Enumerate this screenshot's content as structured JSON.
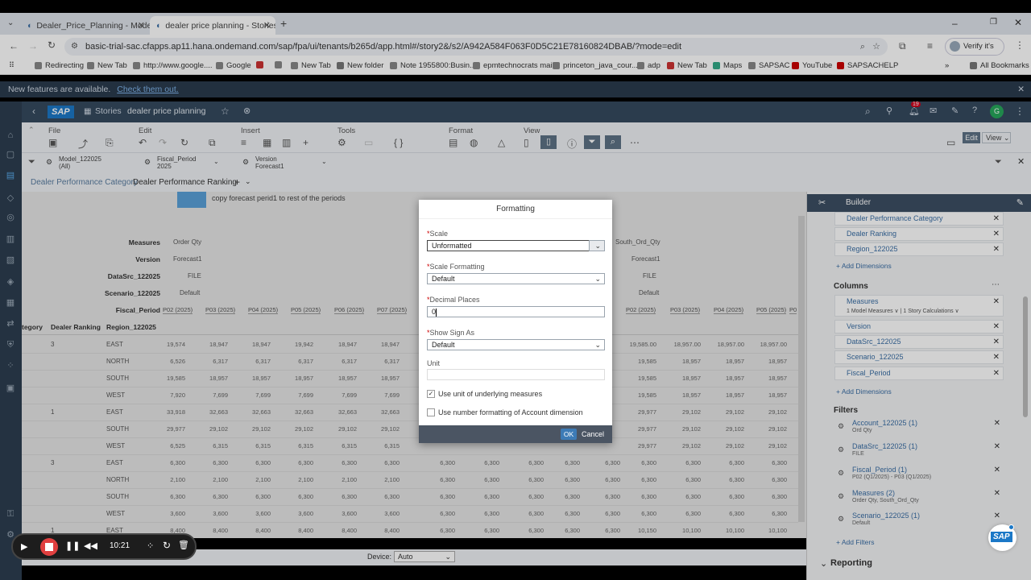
{
  "browser": {
    "tabs": [
      {
        "title": "Dealer_Price_Planning - Modeler"
      },
      {
        "title": "dealer price planning - Stories"
      }
    ],
    "new_tab_icon": "+",
    "url": "basic-trial-sac.cfapps.ap11.hana.ondemand.com/sap/fpa/ui/tenants/b265d/app.html#/story2&/s2/A942A584F063F0D5C21E78160824DBAB/?mode=edit",
    "profile_label": "Verify it's you",
    "bookmarks": [
      "Redirecting",
      "New Tab",
      "http://www.google....",
      "Google",
      "",
      "New Tab",
      "New folder",
      "Note 1955800:Busin...",
      "epmtechnocrats mail",
      "princeton_java_cour...",
      "adp",
      "New Tab",
      "Maps",
      "SAPSAC",
      "YouTube",
      "SAPSACHELP"
    ],
    "all_bookmarks": "All Bookmarks"
  },
  "notification": {
    "text": "New features are available.",
    "link": "Check them out."
  },
  "shell": {
    "logo": "SAP",
    "nav": "Stories",
    "story_name": "dealer price planning",
    "badge": "19",
    "avatar": "G"
  },
  "toolbar": {
    "sections": [
      "File",
      "Edit",
      "Insert",
      "Tools",
      "Format",
      "View"
    ],
    "edit_label": "Edit",
    "view_label": "View"
  },
  "filters": [
    {
      "name": "Model_122025",
      "value": "(All)"
    },
    {
      "name": "Fiscal_Period",
      "value": "2025"
    },
    {
      "name": "Version",
      "value": "Forecast1"
    }
  ],
  "page_tabs": [
    "Dealer Performance Category",
    "Dealer Performance Ranking"
  ],
  "canvas": {
    "banner_text": "copy forecast perid1 to rest of the periods",
    "header_rows": [
      {
        "label": "Measures",
        "value": "Order Qty",
        "right": "South_Ord_Qty"
      },
      {
        "label": "Version",
        "value": "Forecast1",
        "right": "Forecast1"
      },
      {
        "label": "DataSrc_122025",
        "value": "FILE",
        "right": "FILE"
      },
      {
        "label": "Scenario_122025",
        "value": "Default",
        "right": "Default"
      }
    ],
    "fiscal_label": "Fiscal_Period",
    "periods_left": [
      "P02 (2025)",
      "P03 (2025)",
      "P04 (2025)",
      "P05 (2025)",
      "P06 (2025)",
      "P07 (2025)"
    ],
    "periods_right": [
      "P02 (2025)",
      "P03 (2025)",
      "P04 (2025)",
      "P05 (2025)",
      "P0"
    ],
    "col_headers": [
      "tegory",
      "Dealer Ranking",
      "Region_122025"
    ],
    "rows": [
      {
        "rank": "3",
        "region": "EAST",
        "vals": [
          "19,574",
          "18,947",
          "18,947",
          "19,942",
          "18,947",
          "18,947"
        ],
        "rvals": [
          "19,585.00",
          "18,957.00",
          "18,957.00",
          "18,957.00",
          "1"
        ]
      },
      {
        "rank": "",
        "region": "NORTH",
        "vals": [
          "6,526",
          "6,317",
          "6,317",
          "6,317",
          "6,317",
          "6,317"
        ],
        "rvals": [
          "19,585",
          "18,957",
          "18,957",
          "18,957",
          ""
        ]
      },
      {
        "rank": "",
        "region": "SOUTH",
        "vals": [
          "19,585",
          "18,957",
          "18,957",
          "18,957",
          "18,957",
          "18,957"
        ],
        "rvals": [
          "19,585",
          "18,957",
          "18,957",
          "18,957",
          ""
        ]
      },
      {
        "rank": "",
        "region": "WEST",
        "vals": [
          "7,920",
          "7,699",
          "7,699",
          "7,699",
          "7,699",
          "7,699"
        ],
        "rvals": [
          "19,585",
          "18,957",
          "18,957",
          "18,957",
          ""
        ]
      },
      {
        "rank": "1",
        "region": "EAST",
        "vals": [
          "33,918",
          "32,663",
          "32,663",
          "32,663",
          "32,663",
          "32,663"
        ],
        "rvals": [
          "29,977",
          "29,102",
          "29,102",
          "29,102",
          ""
        ]
      },
      {
        "rank": "",
        "region": "SOUTH",
        "vals": [
          "29,977",
          "29,102",
          "29,102",
          "29,102",
          "29,102",
          "29,102"
        ],
        "rvals": [
          "29,977",
          "29,102",
          "29,102",
          "29,102",
          ""
        ]
      },
      {
        "rank": "",
        "region": "WEST",
        "vals": [
          "6,525",
          "6,315",
          "6,315",
          "6,315",
          "6,315",
          "6,315"
        ],
        "rvals": [
          "29,977",
          "29,102",
          "29,102",
          "29,102",
          ""
        ]
      },
      {
        "rank": "3",
        "region": "EAST",
        "vals": [
          "6,300",
          "6,300",
          "6,300",
          "6,300",
          "6,300",
          "6,300"
        ],
        "rvals": [
          "6,300",
          "6,300",
          "6,300",
          "6,300",
          ""
        ]
      },
      {
        "rank": "",
        "region": "NORTH",
        "vals": [
          "2,100",
          "2,100",
          "2,100",
          "2,100",
          "2,100",
          "2,100"
        ],
        "rvals": [
          "6,300",
          "6,300",
          "6,300",
          "6,300",
          ""
        ]
      },
      {
        "rank": "",
        "region": "SOUTH",
        "vals": [
          "6,300",
          "6,300",
          "6,300",
          "6,300",
          "6,300",
          "6,300"
        ],
        "rvals": [
          "6,300",
          "6,300",
          "6,300",
          "6,300",
          ""
        ]
      },
      {
        "rank": "",
        "region": "WEST",
        "vals": [
          "3,600",
          "3,600",
          "3,600",
          "3,600",
          "3,600",
          "3,600"
        ],
        "rvals": [
          "6,300",
          "6,300",
          "6,300",
          "6,300",
          ""
        ]
      },
      {
        "rank": "1",
        "region": "EAST",
        "vals": [
          "8,400",
          "8,400",
          "8,400",
          "8,400",
          "8,400",
          "8,400"
        ],
        "rvals": [
          "10,150",
          "10,100",
          "10,100",
          "10,100",
          ""
        ]
      }
    ],
    "mid_vals": [
      "6,300",
      "6,300",
      "6,300",
      "6,300",
      "6,300"
    ],
    "device_label": "Device:",
    "device_value": "Auto"
  },
  "builder": {
    "title": "Builder",
    "rows_items": [
      "Dealer Performance Category",
      "Dealer Ranking",
      "Region_122025"
    ],
    "add_dimensions": "+ Add Dimensions",
    "columns_title": "Columns",
    "columns_items": [
      "Measures",
      "Version",
      "DataSrc_122025",
      "Scenario_122025",
      "Fiscal_Period"
    ],
    "measures_sub": "1 Model Measures ∨ | 1 Story Calculations ∨",
    "filters_title": "Filters",
    "filters": [
      {
        "name": "Account_122025 (1)",
        "sub": "Ord Qty"
      },
      {
        "name": "DataSrc_122025 (1)",
        "sub": "FILE"
      },
      {
        "name": "Fiscal_Period (1)",
        "sub": "P02 (Q1/2025) - P03 (Q1/2025)"
      },
      {
        "name": "Measures (2)",
        "sub": "Order Qty, South_Ord_Qty"
      },
      {
        "name": "Scenario_122025 (1)",
        "sub": "Default"
      }
    ],
    "add_filters": "+ Add Filters",
    "reporting": "Reporting"
  },
  "dialog": {
    "title": "Formatting",
    "scale_label": "Scale",
    "scale_value": "Unformatted",
    "scale_formatting_label": "Scale Formatting",
    "scale_formatting_value": "Default",
    "decimal_label": "Decimal Places",
    "decimal_value": "0",
    "sign_label": "Show Sign As",
    "sign_value": "Default",
    "unit_label": "Unit",
    "unit_value": "",
    "check1_label": "Use unit of underlying measures",
    "check1_checked": "✓",
    "check2_label": "Use number formatting of Account dimension",
    "ok": "OK",
    "cancel": "Cancel",
    "required": "*"
  },
  "recorder": {
    "time": "10:21"
  }
}
